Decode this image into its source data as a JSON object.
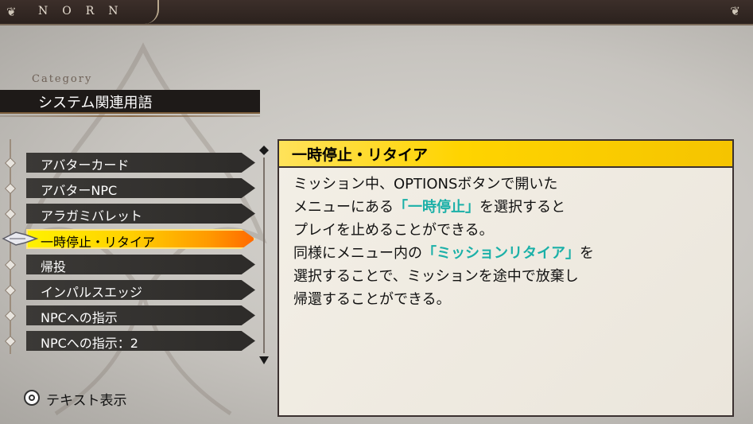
{
  "header": {
    "title": "NORN"
  },
  "category": {
    "label": "Category",
    "value": "システム関連用語"
  },
  "list": {
    "items": [
      {
        "label": "アバターカード"
      },
      {
        "label": "アバターNPC"
      },
      {
        "label": "アラガミバレット"
      },
      {
        "label": "一時停止・リタイア",
        "selected": true
      },
      {
        "label": "帰投"
      },
      {
        "label": "インパルスエッジ"
      },
      {
        "label": "NPCへの指示"
      },
      {
        "label": "NPCへの指示：2"
      }
    ]
  },
  "detail": {
    "title": "一時停止・リタイア",
    "lines": [
      {
        "a": "ミッション中、OPTIONSボタンで開いた",
        "hl": "",
        "b": ""
      },
      {
        "a": "メニューにある",
        "hl": "「一時停止」",
        "b": "を選択すると"
      },
      {
        "a": "プレイを止めることができる。",
        "hl": "",
        "b": ""
      },
      {
        "a": "同様にメニュー内の",
        "hl": "「ミッションリタイア」",
        "b": "を"
      },
      {
        "a": "選択することで、ミッションを途中で放棄し",
        "hl": "",
        "b": ""
      },
      {
        "a": "帰還することができる。",
        "hl": "",
        "b": ""
      }
    ]
  },
  "footer": {
    "button_icon": "circle-button-icon",
    "label": "テキスト表示"
  },
  "colors": {
    "highlight": "#1bb0a8",
    "selected_start": "#fff200",
    "selected_end": "#ff6a00",
    "title_bar": "#ffd400"
  }
}
